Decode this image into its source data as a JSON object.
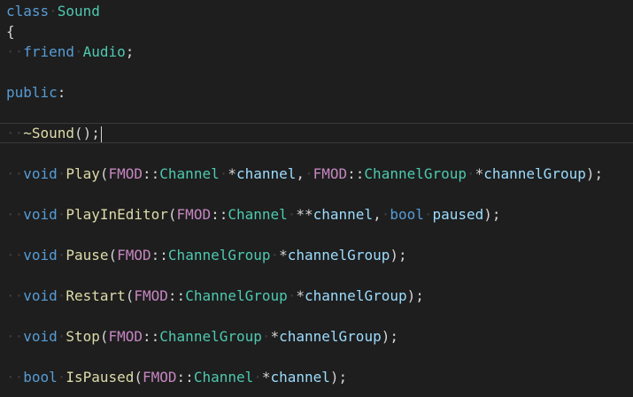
{
  "lines": [
    {
      "i": 0,
      "indent": 0,
      "tokens": [
        {
          "t": "class",
          "c": "kw"
        },
        {
          "t": " ",
          "c": "ws"
        },
        {
          "t": "Sound",
          "c": "type"
        }
      ]
    },
    {
      "i": 1,
      "indent": 0,
      "tokens": [
        {
          "t": "{",
          "c": "punct"
        }
      ]
    },
    {
      "i": 2,
      "indent": 1,
      "tokens": [
        {
          "t": "friend",
          "c": "kw"
        },
        {
          "t": " ",
          "c": "ws"
        },
        {
          "t": "Audio",
          "c": "type"
        },
        {
          "t": ";",
          "c": "punct"
        }
      ]
    },
    {
      "i": 4,
      "indent": 0,
      "tokens": [
        {
          "t": "public",
          "c": "kw"
        },
        {
          "t": ":",
          "c": "punct"
        }
      ]
    },
    {
      "i": 6,
      "indent": 1,
      "current": true,
      "tokens": [
        {
          "t": "~Sound",
          "c": "fn"
        },
        {
          "t": "();",
          "c": "punct"
        }
      ]
    },
    {
      "i": 8,
      "indent": 1,
      "tokens": [
        {
          "t": "void",
          "c": "kw"
        },
        {
          "t": " ",
          "c": "ws"
        },
        {
          "t": "Play",
          "c": "fn"
        },
        {
          "t": "(",
          "c": "punct"
        },
        {
          "t": "FMOD",
          "c": "ns"
        },
        {
          "t": "::",
          "c": "op"
        },
        {
          "t": "Channel",
          "c": "type"
        },
        {
          "t": " ",
          "c": "ws"
        },
        {
          "t": "*",
          "c": "op"
        },
        {
          "t": "channel",
          "c": "param"
        },
        {
          "t": ",",
          "c": "punct"
        },
        {
          "t": " ",
          "c": "ws"
        },
        {
          "t": "FMOD",
          "c": "ns"
        },
        {
          "t": "::",
          "c": "op"
        },
        {
          "t": "ChannelGroup",
          "c": "type"
        },
        {
          "t": " ",
          "c": "ws"
        },
        {
          "t": "*",
          "c": "op"
        },
        {
          "t": "channelGroup",
          "c": "param"
        },
        {
          "t": ");",
          "c": "punct"
        }
      ]
    },
    {
      "i": 10,
      "indent": 1,
      "tokens": [
        {
          "t": "void",
          "c": "kw"
        },
        {
          "t": " ",
          "c": "ws"
        },
        {
          "t": "PlayInEditor",
          "c": "fn"
        },
        {
          "t": "(",
          "c": "punct"
        },
        {
          "t": "FMOD",
          "c": "ns"
        },
        {
          "t": "::",
          "c": "op"
        },
        {
          "t": "Channel",
          "c": "type"
        },
        {
          "t": " ",
          "c": "ws"
        },
        {
          "t": "**",
          "c": "op"
        },
        {
          "t": "channel",
          "c": "param"
        },
        {
          "t": ",",
          "c": "punct"
        },
        {
          "t": " ",
          "c": "ws"
        },
        {
          "t": "bool",
          "c": "kw"
        },
        {
          "t": " ",
          "c": "ws"
        },
        {
          "t": "paused",
          "c": "param"
        },
        {
          "t": ");",
          "c": "punct"
        }
      ]
    },
    {
      "i": 12,
      "indent": 1,
      "tokens": [
        {
          "t": "void",
          "c": "kw"
        },
        {
          "t": " ",
          "c": "ws"
        },
        {
          "t": "Pause",
          "c": "fn"
        },
        {
          "t": "(",
          "c": "punct"
        },
        {
          "t": "FMOD",
          "c": "ns"
        },
        {
          "t": "::",
          "c": "op"
        },
        {
          "t": "ChannelGroup",
          "c": "type"
        },
        {
          "t": " ",
          "c": "ws"
        },
        {
          "t": "*",
          "c": "op"
        },
        {
          "t": "channelGroup",
          "c": "param"
        },
        {
          "t": ");",
          "c": "punct"
        }
      ]
    },
    {
      "i": 14,
      "indent": 1,
      "tokens": [
        {
          "t": "void",
          "c": "kw"
        },
        {
          "t": " ",
          "c": "ws"
        },
        {
          "t": "Restart",
          "c": "fn"
        },
        {
          "t": "(",
          "c": "punct"
        },
        {
          "t": "FMOD",
          "c": "ns"
        },
        {
          "t": "::",
          "c": "op"
        },
        {
          "t": "ChannelGroup",
          "c": "type"
        },
        {
          "t": " ",
          "c": "ws"
        },
        {
          "t": "*",
          "c": "op"
        },
        {
          "t": "channelGroup",
          "c": "param"
        },
        {
          "t": ");",
          "c": "punct"
        }
      ]
    },
    {
      "i": 16,
      "indent": 1,
      "tokens": [
        {
          "t": "void",
          "c": "kw"
        },
        {
          "t": " ",
          "c": "ws"
        },
        {
          "t": "Stop",
          "c": "fn"
        },
        {
          "t": "(",
          "c": "punct"
        },
        {
          "t": "FMOD",
          "c": "ns"
        },
        {
          "t": "::",
          "c": "op"
        },
        {
          "t": "ChannelGroup",
          "c": "type"
        },
        {
          "t": " ",
          "c": "ws"
        },
        {
          "t": "*",
          "c": "op"
        },
        {
          "t": "channelGroup",
          "c": "param"
        },
        {
          "t": ");",
          "c": "punct"
        }
      ]
    },
    {
      "i": 18,
      "indent": 1,
      "tokens": [
        {
          "t": "bool",
          "c": "kw"
        },
        {
          "t": " ",
          "c": "ws"
        },
        {
          "t": "IsPaused",
          "c": "fn"
        },
        {
          "t": "(",
          "c": "punct"
        },
        {
          "t": "FMOD",
          "c": "ns"
        },
        {
          "t": "::",
          "c": "op"
        },
        {
          "t": "Channel",
          "c": "type"
        },
        {
          "t": " ",
          "c": "ws"
        },
        {
          "t": "*",
          "c": "op"
        },
        {
          "t": "channel",
          "c": "param"
        },
        {
          "t": ");",
          "c": "punct"
        }
      ]
    }
  ],
  "colors": {
    "background": "#1e1e1e",
    "keyword": "#569cd6",
    "type": "#4ec9b0",
    "function": "#dcdcaa",
    "namespace": "#c586c0",
    "parameter": "#9cdcfe",
    "punctuation": "#d4d4d4",
    "whitespace_marker": "#3e3e42"
  }
}
